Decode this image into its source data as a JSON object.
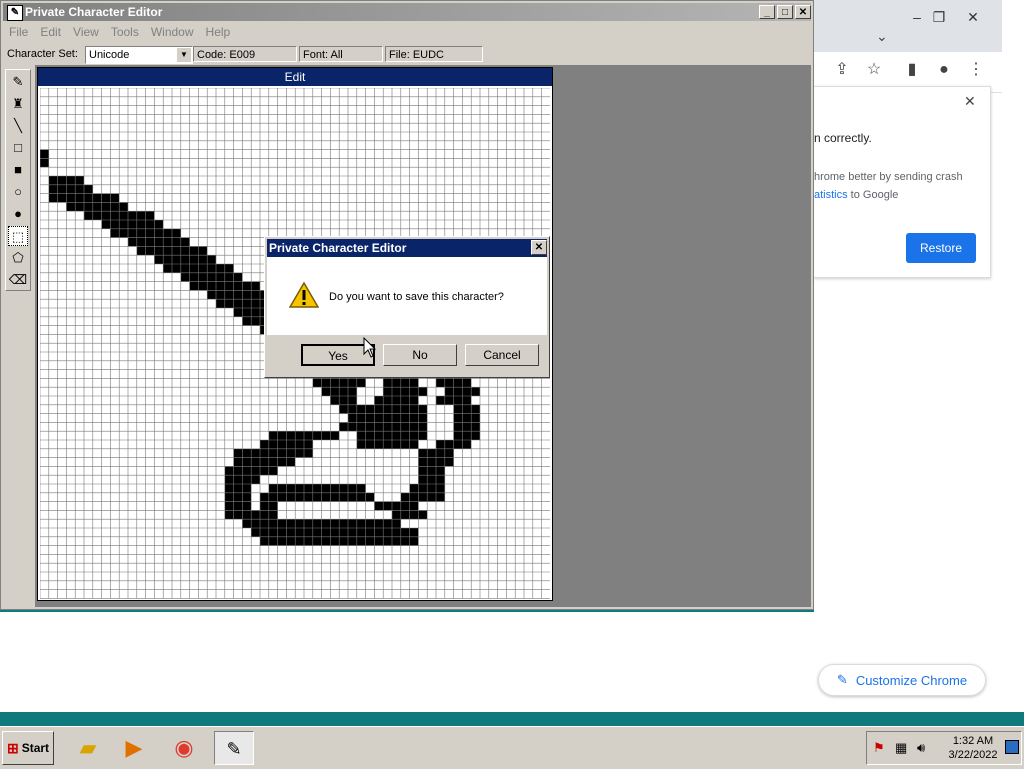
{
  "pce": {
    "title": "Private Character Editor",
    "menu": [
      "File",
      "Edit",
      "View",
      "Tools",
      "Window",
      "Help"
    ],
    "charset_label": "Character Set:",
    "charset_value": "Unicode",
    "code": "Code: E009",
    "font": "Font: All",
    "file": "File: EUDC",
    "edit_title": "Edit",
    "glyph_rows": [
      "..........................................................",
      "..........................................................",
      "..........................................................",
      "..........................................................",
      "..........................................................",
      "..........................................................",
      "..........................................................",
      "#.........................................................",
      "#.........................................................",
      "..........................................................",
      ".####.....................................................",
      ".#####....................................................",
      ".########.................................................",
      "...#######................................................",
      ".....########.............................................",
      ".......#######............................................",
      "........########..........................................",
      "..........#######.........................................",
      "...........########.......................................",
      ".............#######......................................",
      "..............########....................................",
      "................#######...................................",
      ".................########.................................",
      "...................#######................................",
      "....................########..............................",
      "......................#######.............................",
      ".......................########...........................",
      ".........................#######..........................",
      "..........................########........................",
      "............................#######........................",
      ".............................#######......................",
      "..............................############.#######.........",
      "...............................############.#####..........",
      "...............................######..####..####.........",
      "................................####...#####..####........",
      ".................................###..#####..####.........",
      "..................................##########...###........",
      "...................................#########...###........",
      "..................................##########...###........",
      "..........................########..########...###........",
      ".........................######.....#######..####.........",
      "......................#########............####...........",
      "......................#######..............####...........",
      ".....................######................###............",
      ".....................####..................###............",
      ".....................###..###########.....####............",
      ".....................###.#############...#####............",
      ".....................###.##...........#####...............",
      ".....................######.............####..............",
      ".......................##################.................",
      "........................###################...............",
      ".........................##################..............."
    ]
  },
  "dialog": {
    "title": "Private Character Editor",
    "message": "Do you want to save this character?",
    "yes": "Yes",
    "no": "No",
    "cancel": "Cancel"
  },
  "chrome": {
    "msg1": "n correctly.",
    "msg2": "hrome better by sending crash",
    "msg3_link": "atistics",
    "msg3_rest": " to Google",
    "restore": "Restore",
    "customize": "Customize Chrome"
  },
  "taskbar": {
    "start": "Start",
    "time": "1:32 AM",
    "date": "3/22/2022"
  }
}
